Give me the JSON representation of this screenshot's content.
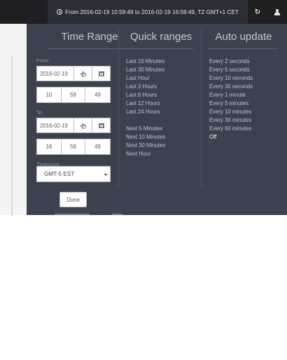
{
  "topbar": {
    "time_range_text": "From 2016-02-19 10:59:49 to 2016-02-19 16:59:49, TZ GMT+1 CET",
    "icons": {
      "clock": "clock-icon",
      "refresh": "refresh-icon",
      "user": "user-icon"
    }
  },
  "time_range": {
    "title": "Time Range",
    "from": {
      "label": "From",
      "date": "2016-02-19",
      "hour": "10",
      "minute": "59",
      "second": "49"
    },
    "to": {
      "label": "To",
      "date": "2016-02-19",
      "hour": "16",
      "minute": "59",
      "second": "49"
    },
    "timezone": {
      "label": "Timezone",
      "value": "GMT-5 EST"
    },
    "done_label": "Done"
  },
  "quick_ranges": {
    "title": "Quick ranges",
    "items": [
      "Last 10 Minutes",
      "Last 30 Minutes",
      "Last Hour",
      "Last 3 Hours",
      "Last 6 Hours",
      "Last 12 Hours",
      "Last 24 Hours",
      "Next 5 Minutes",
      "Next 10 Minutes",
      "Next 30 Minutes",
      "Next Hour"
    ]
  },
  "auto_update": {
    "title": "Auto update",
    "items": [
      "Every 2 seconds",
      "Every 5 seconds",
      "Every 10 seconds",
      "Every 30 seconds",
      "Every 1 minute",
      "Every 5 minutes",
      "Every 10 minutes",
      "Every 30 minutes",
      "Every 60 minutes",
      "Off"
    ],
    "selected": "Off"
  },
  "colors": {
    "panel": "#3b424d",
    "topbar": "#1f1f22",
    "link": "#b7c4d4",
    "title": "#c5c9d0"
  }
}
